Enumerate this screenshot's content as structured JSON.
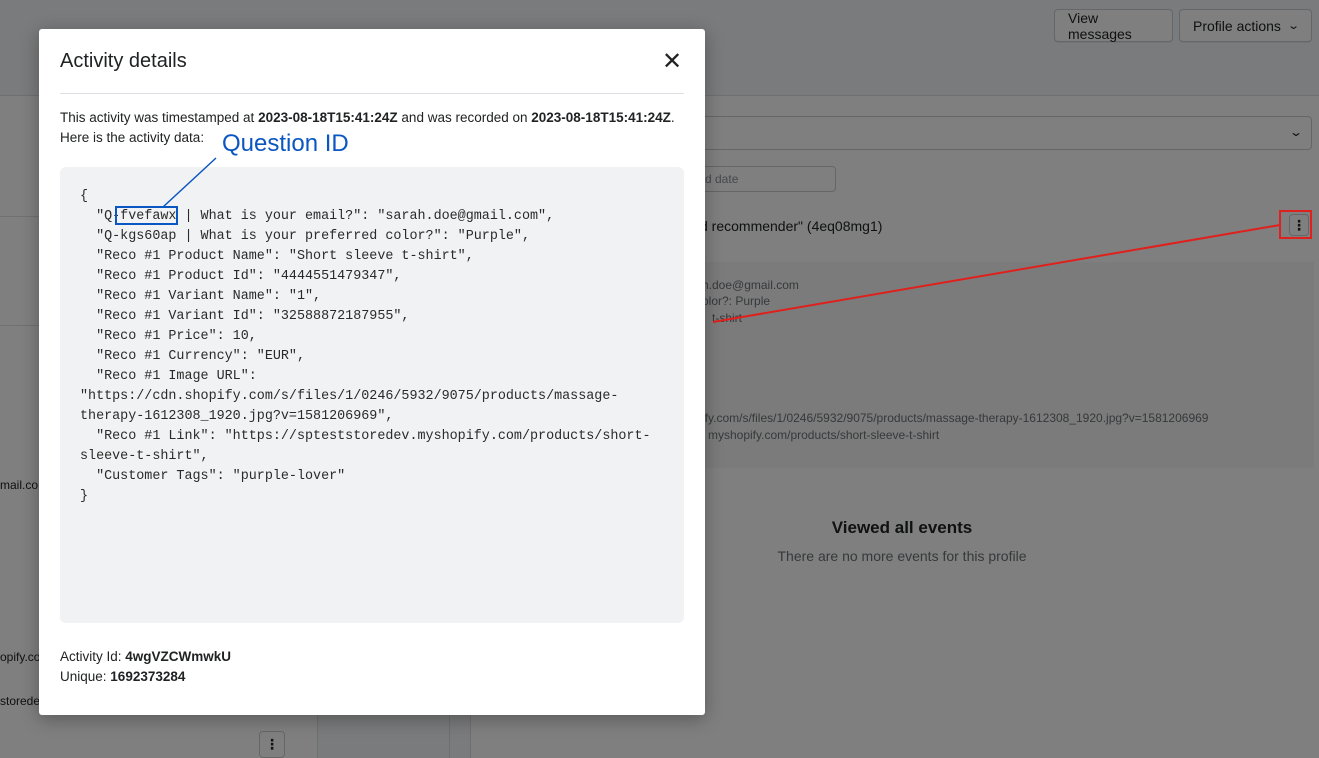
{
  "background": {
    "buttons": {
      "view_messages": "View messages",
      "profile_actions": "Profile actions"
    },
    "left_fragments": [
      "mail.co",
      "opify.co",
      "storede"
    ],
    "date_placeholder": "d date",
    "event_title": "d recommender\" (4eq08mg1)",
    "event_lines": [
      "h.doe@gmail.com",
      "olor?: Purple",
      "t-shirt",
      "ify.com/s/files/1/0246/5932/9075/products/massage-therapy-1612308_1920.jpg?v=1581206969",
      "myshopify.com/products/short-sleeve-t-shirt"
    ],
    "viewed_title": "Viewed all events",
    "viewed_sub": "There are no more events for this profile",
    "icons": {
      "chevron": "chevron-down-icon",
      "kebab": "kebab-menu-icon"
    }
  },
  "modal": {
    "title": "Activity details",
    "close_icon": "close-icon",
    "intro_pre": "This activity was timestamped at ",
    "timestamped_at": "2023-08-18T15:41:24Z",
    "intro_mid": " and was recorded on ",
    "recorded_on": "2023-08-18T15:41:24Z",
    "intro_post": ". Here is the activity data:",
    "activity_data": [
      "{",
      "  \"Q-fvefawx | What is your email?\": \"sarah.doe@gmail.com\",",
      "  \"Q-kgs60ap | What is your preferred color?\": \"Purple\",",
      "  \"Reco #1 Product Name\": \"Short sleeve t-shirt\",",
      "  \"Reco #1 Product Id\": \"4444551479347\",",
      "  \"Reco #1 Variant Name\": \"1\",",
      "  \"Reco #1 Variant Id\": \"32588872187955\",",
      "  \"Reco #1 Price\": 10,",
      "  \"Reco #1 Currency\": \"EUR\",",
      "  \"Reco #1 Image URL\":",
      "\"https://cdn.shopify.com/s/files/1/0246/5932/9075/products/massage-",
      "therapy-1612308_1920.jpg?v=1581206969\",",
      "  \"Reco #1 Link\": \"https://spteststoredev.myshopify.com/products/short-",
      "sleeve-t-shirt\",",
      "  \"Customer Tags\": \"purple-lover\"",
      "}"
    ],
    "activity_id_label": "Activity Id: ",
    "activity_id": "4wgVZCWmwkU",
    "unique_label": "Unique: ",
    "unique": "1692373284"
  },
  "annotations": {
    "question_id_label": "Question ID",
    "colors": {
      "blue": "#0a56c2",
      "red": "#e0201c"
    }
  }
}
